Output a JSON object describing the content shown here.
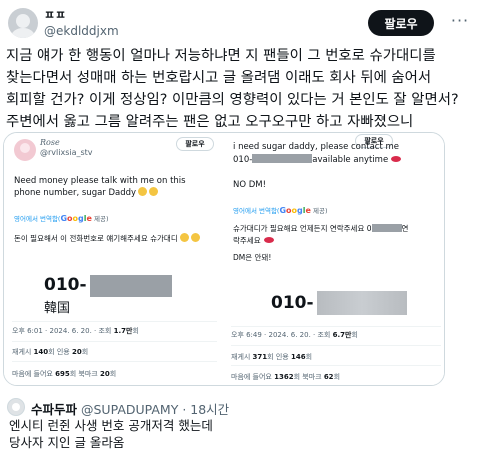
{
  "tweet": {
    "display_name": "ㅍㅍ",
    "handle": "@ekdlddjxm",
    "follow_label": "팔로우",
    "more_label": "···",
    "text": "지금 얘가 한 행동이 얼마나 저능하냐면 지 팬들이 그 번호로 슈가대디를 찾는다면서 성매매 하는 번호랍시고 글 올려댐 이래도 회사 뒤에 숨어서 회피할 건가? 이게 정상임? 이만큼의 영향력이 있다는 거 본인도 잘 알면서? 주변에서 옳고 그름 알려주는 팬은 없고 오구오구만 하고 자빠졌으니"
  },
  "media": {
    "left": {
      "name": "Rose",
      "handle": "@rvlixsia_stv",
      "follow_label": "팔로우",
      "text": "Need money please talk with me on this phone number, sugar Daddy",
      "translate_prefix": "영어에서 번역함(",
      "translate_suffix": " 제공)",
      "translated": "돈이 필요해서 이 전화번호로 얘기해주세요 슈가대디",
      "phone_prefix": "010-",
      "country": "韓国",
      "time": "오후 6:01 · 2024. 6. 20. · 조회 ",
      "views": "1.7만",
      "views_suffix": "회",
      "retweets_label": "재게시 ",
      "retweets": "140",
      "retweets_suffix": "회",
      "quotes_label": " 인용 ",
      "quotes": "20",
      "quotes_suffix": "회",
      "likes_label": "마음에 들어요 ",
      "likes": "695",
      "likes_suffix": "회",
      "bookmarks_label": " 북마크 ",
      "bookmarks": "20",
      "bookmarks_suffix": "회"
    },
    "right": {
      "follow_label": "팔로우",
      "line1": "i need sugar daddy, please contact me",
      "line2_prefix": "010-",
      "line2_suffix": "available anytime",
      "line3": "NO DM!",
      "translate_prefix": "영어에서 번역함(",
      "translate_suffix": " 제공)",
      "translated_1": "슈가대디가 필요해요 언제든지 연락주세요 0",
      "translated_1b": "연",
      "translated_2": "락주세요",
      "translated_3": "DM은 안돼!",
      "phone_prefix": "010-",
      "time": "오후 6:49 · 2024. 6. 20. · 조회 ",
      "views": "6.7만",
      "views_suffix": "회",
      "retweets_label": "재게시 ",
      "retweets": "371",
      "retweets_suffix": "회",
      "quotes_label": " 인용 ",
      "quotes": "146",
      "quotes_suffix": "회",
      "likes_label": "마음에 들어요 ",
      "likes": "1362",
      "likes_suffix": "회",
      "bookmarks_label": " 북마크 ",
      "bookmarks": "62",
      "bookmarks_suffix": "회"
    },
    "google": [
      "G",
      "o",
      "o",
      "g",
      "l",
      "e"
    ]
  },
  "quote": {
    "name": "수파두파",
    "handle": "@SUPADUPAMY",
    "separator": " · ",
    "time": "18시간",
    "text": "엔시티 런쥔 사생 번호 공개저격 했는데\n당사자 지인 글 올라옴"
  }
}
